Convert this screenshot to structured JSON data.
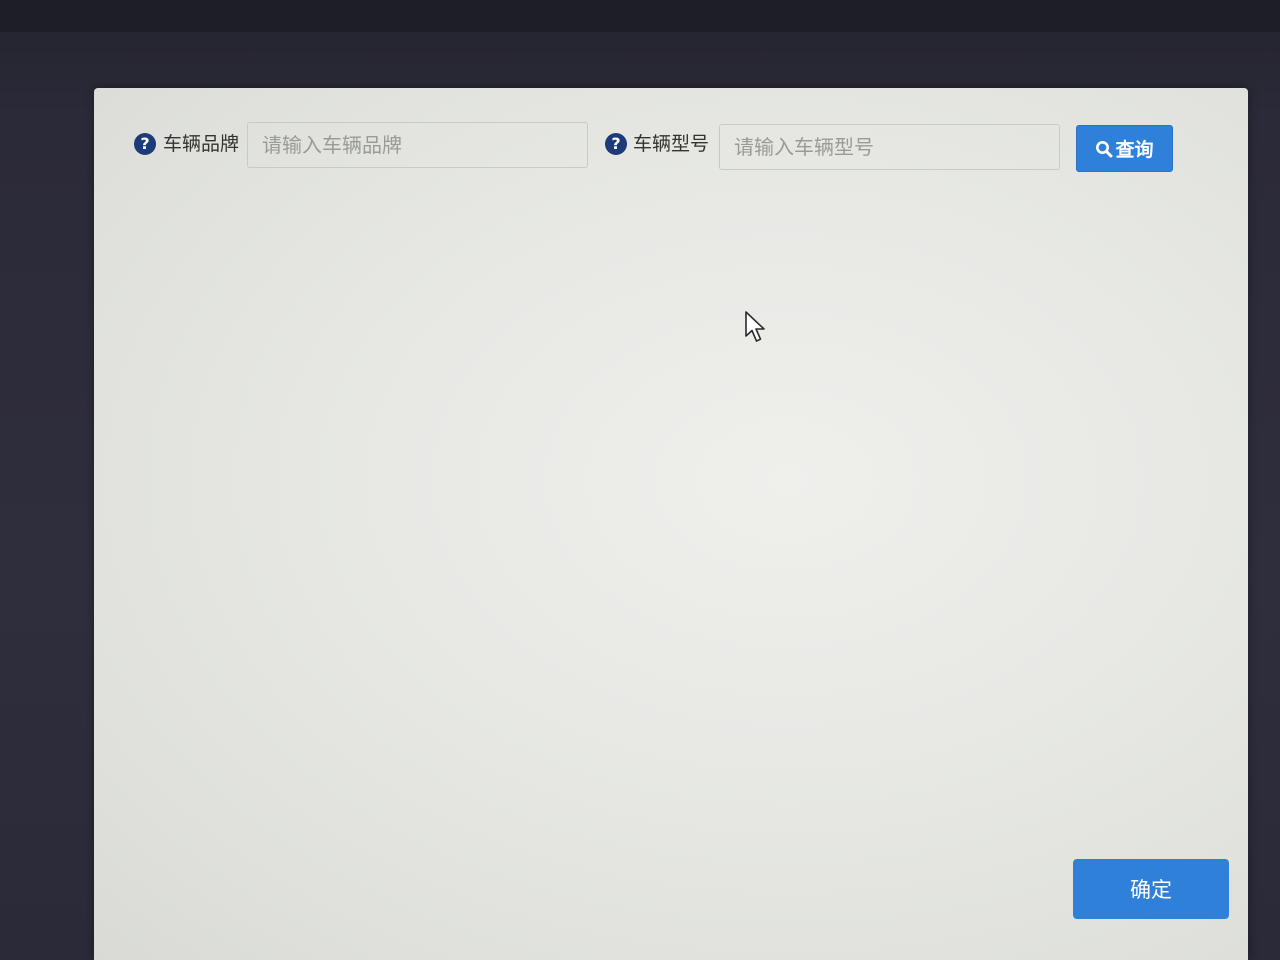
{
  "filters": {
    "brand": {
      "label": "车辆品牌",
      "placeholder": "请输入车辆品牌",
      "value": ""
    },
    "model": {
      "label": "车辆型号",
      "placeholder": "请输入车辆型号",
      "value": ""
    },
    "help_icon_glyph": "?",
    "query_button_label": "查询",
    "query_button_icon": "search-icon"
  },
  "footer": {
    "confirm_label": "确定"
  },
  "colors": {
    "primary_button": "#2f80d8",
    "help_icon": "#1d3b78",
    "dialog_background": "#e7e8e4",
    "placeholder_text": "#9a9b98"
  }
}
